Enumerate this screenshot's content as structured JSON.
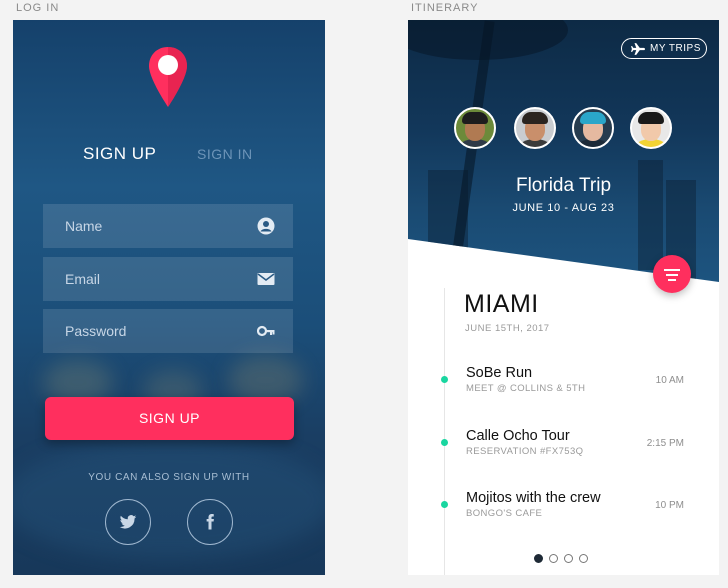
{
  "captions": {
    "login": "LOG IN",
    "itinerary": "ITINERARY"
  },
  "login": {
    "tabs": {
      "signup": "SIGN UP",
      "signin": "SIGN IN"
    },
    "fields": {
      "name": "Name",
      "email": "Email",
      "password": "Password"
    },
    "signup_button": "SIGN UP",
    "also_text": "YOU CAN ALSO SIGN UP WITH",
    "social": [
      "twitter-icon",
      "facebook-icon"
    ],
    "icons": {
      "logo": "map-pin-icon",
      "name": "user-icon",
      "email": "envelope-icon",
      "password": "key-icon"
    },
    "colors": {
      "accent": "#ff2f5e",
      "background": "#1f5784"
    }
  },
  "itinerary": {
    "my_trips": "MY TRIPS",
    "trip_title": "Florida Trip",
    "trip_dates": "JUNE 10 - AUG 23",
    "city": "MIAMI",
    "city_date": "JUNE 15TH, 2017",
    "events": [
      {
        "name": "SoBe Run",
        "sub": "MEET @ COLLINS & 5TH",
        "time": "10 AM"
      },
      {
        "name": "Calle Ocho Tour",
        "sub": "RESERVATION #FX753Q",
        "time": "2:15 PM"
      },
      {
        "name": "Mojitos with the crew",
        "sub": "BONGO'S CAFE",
        "time": "10 PM"
      }
    ],
    "pager": {
      "pages": 4,
      "active": 1
    },
    "colors": {
      "accent": "#ff2f5e",
      "timeline_dot": "#19d6a0"
    }
  }
}
